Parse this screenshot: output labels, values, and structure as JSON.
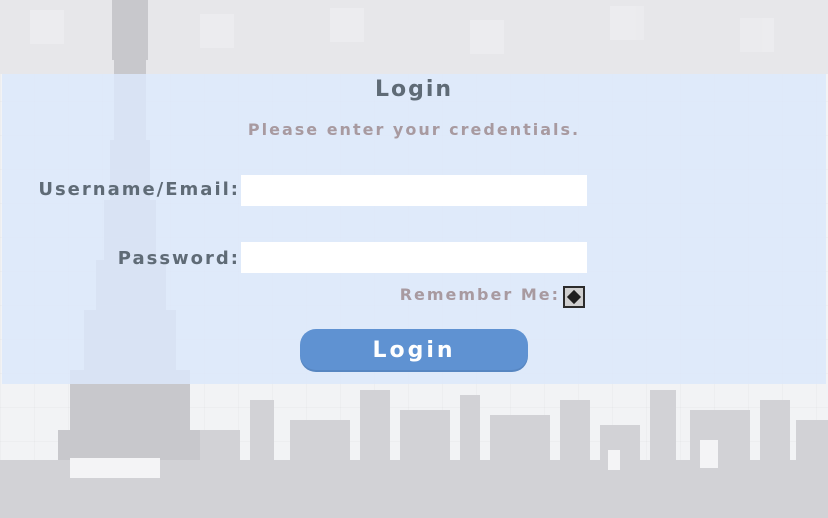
{
  "page": {
    "title": "Login",
    "subtitle": "Please enter your credentials."
  },
  "form": {
    "username_label": "Username/Email:",
    "username_value": "",
    "password_label": "Password:",
    "password_value": "",
    "remember_label": "Remember Me:",
    "remember_checked": true,
    "submit_label": "Login"
  },
  "colors": {
    "panel": "#dce8fa",
    "heading_text": "#5f6b76",
    "muted_text": "#a89aa0",
    "button": "#5f92d2",
    "button_text": "#ffffff"
  },
  "background": {
    "scene": "pixelated Eiffel Tower and city skyline silhouette"
  }
}
